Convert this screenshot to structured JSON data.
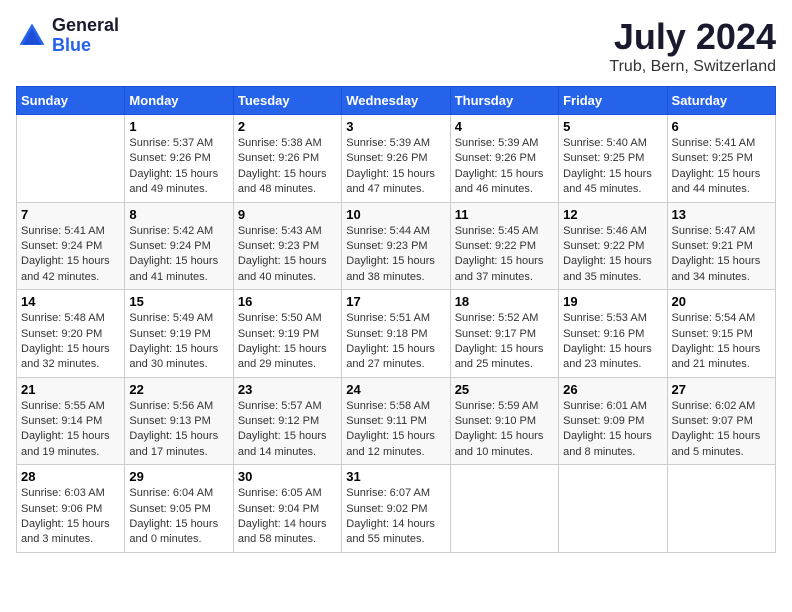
{
  "header": {
    "logo_general": "General",
    "logo_blue": "Blue",
    "month_year": "July 2024",
    "location": "Trub, Bern, Switzerland"
  },
  "days_of_week": [
    "Sunday",
    "Monday",
    "Tuesday",
    "Wednesday",
    "Thursday",
    "Friday",
    "Saturday"
  ],
  "weeks": [
    [
      {
        "day": "",
        "info": ""
      },
      {
        "day": "1",
        "info": "Sunrise: 5:37 AM\nSunset: 9:26 PM\nDaylight: 15 hours\nand 49 minutes."
      },
      {
        "day": "2",
        "info": "Sunrise: 5:38 AM\nSunset: 9:26 PM\nDaylight: 15 hours\nand 48 minutes."
      },
      {
        "day": "3",
        "info": "Sunrise: 5:39 AM\nSunset: 9:26 PM\nDaylight: 15 hours\nand 47 minutes."
      },
      {
        "day": "4",
        "info": "Sunrise: 5:39 AM\nSunset: 9:26 PM\nDaylight: 15 hours\nand 46 minutes."
      },
      {
        "day": "5",
        "info": "Sunrise: 5:40 AM\nSunset: 9:25 PM\nDaylight: 15 hours\nand 45 minutes."
      },
      {
        "day": "6",
        "info": "Sunrise: 5:41 AM\nSunset: 9:25 PM\nDaylight: 15 hours\nand 44 minutes."
      }
    ],
    [
      {
        "day": "7",
        "info": "Sunrise: 5:41 AM\nSunset: 9:24 PM\nDaylight: 15 hours\nand 42 minutes."
      },
      {
        "day": "8",
        "info": "Sunrise: 5:42 AM\nSunset: 9:24 PM\nDaylight: 15 hours\nand 41 minutes."
      },
      {
        "day": "9",
        "info": "Sunrise: 5:43 AM\nSunset: 9:23 PM\nDaylight: 15 hours\nand 40 minutes."
      },
      {
        "day": "10",
        "info": "Sunrise: 5:44 AM\nSunset: 9:23 PM\nDaylight: 15 hours\nand 38 minutes."
      },
      {
        "day": "11",
        "info": "Sunrise: 5:45 AM\nSunset: 9:22 PM\nDaylight: 15 hours\nand 37 minutes."
      },
      {
        "day": "12",
        "info": "Sunrise: 5:46 AM\nSunset: 9:22 PM\nDaylight: 15 hours\nand 35 minutes."
      },
      {
        "day": "13",
        "info": "Sunrise: 5:47 AM\nSunset: 9:21 PM\nDaylight: 15 hours\nand 34 minutes."
      }
    ],
    [
      {
        "day": "14",
        "info": "Sunrise: 5:48 AM\nSunset: 9:20 PM\nDaylight: 15 hours\nand 32 minutes."
      },
      {
        "day": "15",
        "info": "Sunrise: 5:49 AM\nSunset: 9:19 PM\nDaylight: 15 hours\nand 30 minutes."
      },
      {
        "day": "16",
        "info": "Sunrise: 5:50 AM\nSunset: 9:19 PM\nDaylight: 15 hours\nand 29 minutes."
      },
      {
        "day": "17",
        "info": "Sunrise: 5:51 AM\nSunset: 9:18 PM\nDaylight: 15 hours\nand 27 minutes."
      },
      {
        "day": "18",
        "info": "Sunrise: 5:52 AM\nSunset: 9:17 PM\nDaylight: 15 hours\nand 25 minutes."
      },
      {
        "day": "19",
        "info": "Sunrise: 5:53 AM\nSunset: 9:16 PM\nDaylight: 15 hours\nand 23 minutes."
      },
      {
        "day": "20",
        "info": "Sunrise: 5:54 AM\nSunset: 9:15 PM\nDaylight: 15 hours\nand 21 minutes."
      }
    ],
    [
      {
        "day": "21",
        "info": "Sunrise: 5:55 AM\nSunset: 9:14 PM\nDaylight: 15 hours\nand 19 minutes."
      },
      {
        "day": "22",
        "info": "Sunrise: 5:56 AM\nSunset: 9:13 PM\nDaylight: 15 hours\nand 17 minutes."
      },
      {
        "day": "23",
        "info": "Sunrise: 5:57 AM\nSunset: 9:12 PM\nDaylight: 15 hours\nand 14 minutes."
      },
      {
        "day": "24",
        "info": "Sunrise: 5:58 AM\nSunset: 9:11 PM\nDaylight: 15 hours\nand 12 minutes."
      },
      {
        "day": "25",
        "info": "Sunrise: 5:59 AM\nSunset: 9:10 PM\nDaylight: 15 hours\nand 10 minutes."
      },
      {
        "day": "26",
        "info": "Sunrise: 6:01 AM\nSunset: 9:09 PM\nDaylight: 15 hours\nand 8 minutes."
      },
      {
        "day": "27",
        "info": "Sunrise: 6:02 AM\nSunset: 9:07 PM\nDaylight: 15 hours\nand 5 minutes."
      }
    ],
    [
      {
        "day": "28",
        "info": "Sunrise: 6:03 AM\nSunset: 9:06 PM\nDaylight: 15 hours\nand 3 minutes."
      },
      {
        "day": "29",
        "info": "Sunrise: 6:04 AM\nSunset: 9:05 PM\nDaylight: 15 hours\nand 0 minutes."
      },
      {
        "day": "30",
        "info": "Sunrise: 6:05 AM\nSunset: 9:04 PM\nDaylight: 14 hours\nand 58 minutes."
      },
      {
        "day": "31",
        "info": "Sunrise: 6:07 AM\nSunset: 9:02 PM\nDaylight: 14 hours\nand 55 minutes."
      },
      {
        "day": "",
        "info": ""
      },
      {
        "day": "",
        "info": ""
      },
      {
        "day": "",
        "info": ""
      }
    ]
  ]
}
